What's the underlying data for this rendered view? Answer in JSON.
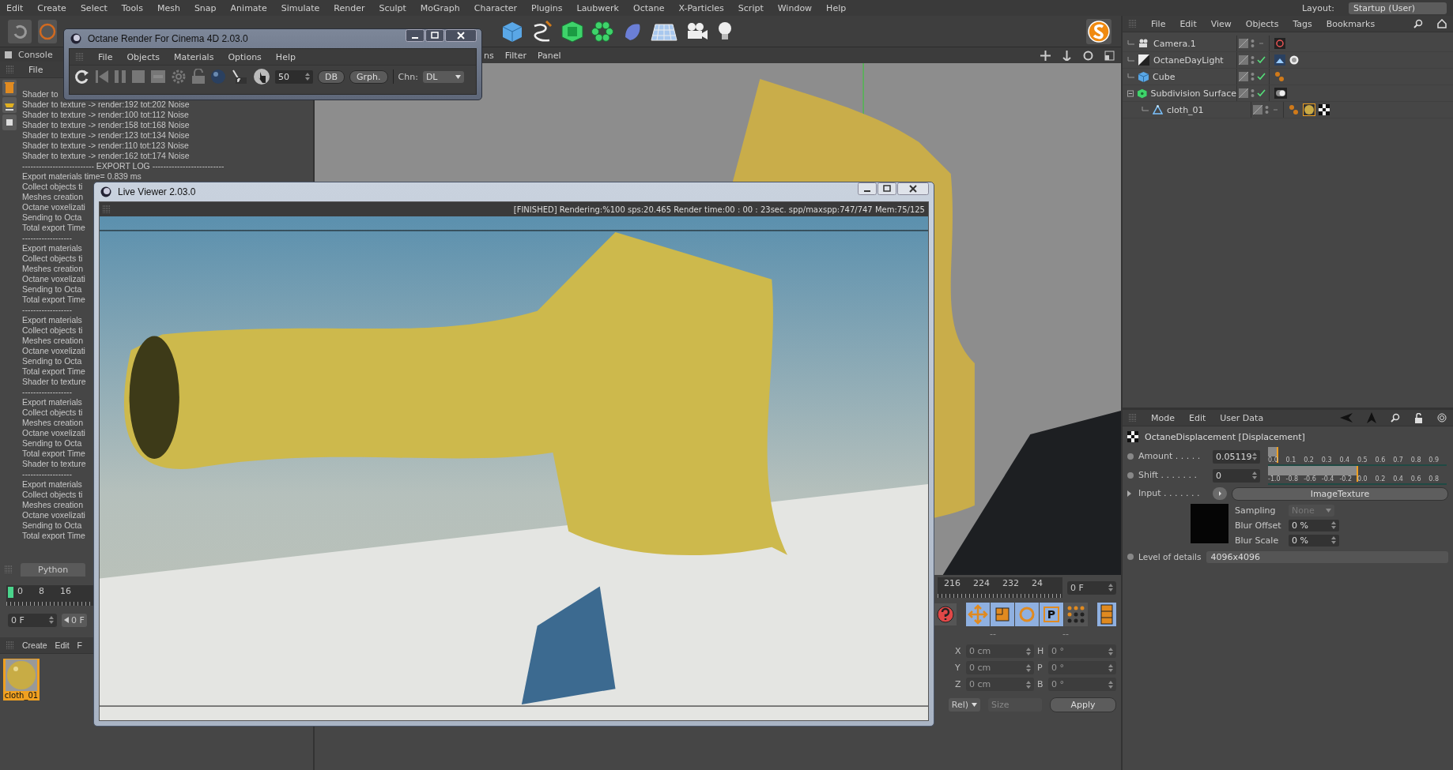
{
  "menu_bar": {
    "items": [
      "Edit",
      "Create",
      "Select",
      "Tools",
      "Mesh",
      "Snap",
      "Animate",
      "Simulate",
      "Render",
      "Sculpt",
      "MoGraph",
      "Character",
      "Plugins",
      "Laubwerk",
      "Octane",
      "X-Particles",
      "Script",
      "Window",
      "Help"
    ],
    "layout_label": "Layout:",
    "layout_value": "Startup (User)"
  },
  "console": {
    "title": "Console",
    "menu": [
      "File"
    ],
    "lines": [
      "Shader to",
      "Shader to texture -> render:192 tot:202 Noise",
      "Shader to texture -> render:100 tot:112 Noise",
      "Shader to texture -> render:158 tot:168 Noise",
      "Shader to texture -> render:123 tot:134 Noise",
      "Shader to texture -> render:110 tot:123 Noise",
      "Shader to texture -> render:162 tot:174 Noise",
      "-------------------------- EXPORT LOG --------------------------",
      "Export materials time= 0.839 ms",
      "Collect objects ti",
      "Meshes creation",
      "Octane voxelizati",
      "Sending to Octa",
      "Total export Time",
      "------------------",
      "Export materials",
      "Collect objects ti",
      "Meshes creation",
      "Octane voxelizati",
      "Sending to Octa",
      "Total export Time",
      "------------------",
      "Export materials",
      "Collect objects ti",
      "Meshes creation",
      "Octane voxelizati",
      "Sending to Octa",
      "Total export Time",
      "Shader to texture",
      "------------------",
      "Export materials",
      "Collect objects ti",
      "Meshes creation",
      "Octane voxelizati",
      "Sending to Octa",
      "Total export Time",
      "Shader to texture",
      "------------------",
      "Export materials",
      "Collect objects ti",
      "Meshes creation",
      "Octane voxelizati",
      "Sending to Octa",
      "Total export Time"
    ],
    "tab": "Python"
  },
  "left_timeline": {
    "ticks": [
      "0",
      "8",
      "16"
    ],
    "frame_field": "0 F",
    "start_button": "0 F"
  },
  "material_manager": {
    "menu": [
      "Create",
      "Edit",
      "F"
    ],
    "materials": [
      {
        "name": "cloth_01",
        "selected": true
      }
    ]
  },
  "viewport": {
    "menu": [
      "ns",
      "Filter",
      "Panel"
    ]
  },
  "timeline": {
    "ticks": [
      "216",
      "224",
      "232",
      "24"
    ],
    "frame_field": "0 F"
  },
  "tools": {
    "param_label": "P"
  },
  "coordinates": {
    "headers": [
      "--",
      "--"
    ],
    "rows": [
      {
        "axis": "X",
        "value": "0 cm",
        "rot_axis": "H",
        "rot_value": "0 °"
      },
      {
        "axis": "Y",
        "value": "0 cm",
        "rot_axis": "P",
        "rot_value": "0 °"
      },
      {
        "axis": "Z",
        "value": "0 cm",
        "rot_axis": "B",
        "rot_value": "0 °"
      }
    ],
    "mode_dropdown": "Rel)",
    "size_dropdown": "Size",
    "apply_button": "Apply"
  },
  "object_manager": {
    "menu": [
      "File",
      "Edit",
      "View",
      "Objects",
      "Tags",
      "Bookmarks"
    ],
    "objects": [
      {
        "name": "Camera.1",
        "kind": "camera",
        "enabled": false
      },
      {
        "name": "OctaneDayLight",
        "kind": "light",
        "enabled": true
      },
      {
        "name": "Cube",
        "kind": "cube",
        "enabled": true
      },
      {
        "name": "Subdivision Surface",
        "kind": "subdivision",
        "enabled": true,
        "expanded": true,
        "children": [
          {
            "name": "cloth_01",
            "kind": "polygon",
            "enabled": false
          }
        ]
      }
    ]
  },
  "attributes": {
    "menu": [
      "Mode",
      "Edit",
      "User Data"
    ],
    "title": "OctaneDisplacement [Displacement]",
    "amount": {
      "label": "Amount . . . . .",
      "value": "0.05119",
      "level": 0.051,
      "ticks": [
        "0.0",
        "0.1",
        "0.2",
        "0.3",
        "0.4",
        "0.5",
        "0.6",
        "0.7",
        "0.8",
        "0.9"
      ]
    },
    "shift": {
      "label": "Shift . . . . . . .",
      "value": "0",
      "level": 0.5,
      "ticks": [
        "-1.0",
        "-0.8",
        "-0.6",
        "-0.4",
        "-0.2",
        "0.0",
        "0.2",
        "0.4",
        "0.6",
        "0.8"
      ]
    },
    "input": {
      "label": "Input . . . . . . .",
      "texture_button": "ImageTexture"
    },
    "sampling": {
      "label": "Sampling",
      "value": "None",
      "disabled": true
    },
    "blur_offset": {
      "label": "Blur Offset",
      "value": "0 %"
    },
    "blur_scale": {
      "label": "Blur Scale",
      "value": "0 %"
    },
    "level_of_details": {
      "label": "Level of details",
      "value": "4096x4096"
    }
  },
  "octane_window": {
    "title": "Octane Render For Cinema 4D 2.03.0",
    "menu": [
      "File",
      "Objects",
      "Materials",
      "Options",
      "Help"
    ],
    "samples_value": "50",
    "db_button": "DB",
    "graph_button": "Grph.",
    "channel_label": "Chn:",
    "channel_value": "DL"
  },
  "live_viewer": {
    "title": "Live Viewer 2.03.0",
    "status": "[FINISHED]  Rendering:%100 sps:20.465 Render time:00 : 00 : 23sec. spp/maxspp:747/747 Mem:75/125"
  }
}
